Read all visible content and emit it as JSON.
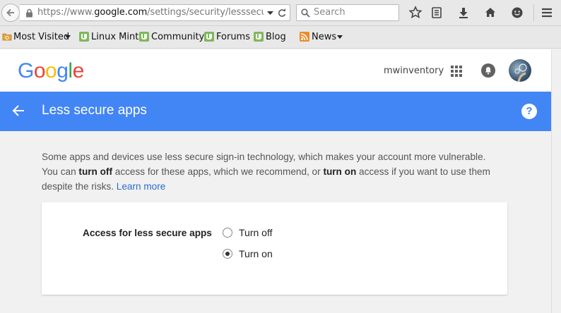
{
  "browser": {
    "url_prefix": "https://www.",
    "url_domain": "google.com",
    "url_path": "/settings/security/lesssecureapps",
    "search_placeholder": "Search"
  },
  "bookmarks": [
    {
      "label": "Most Visited",
      "icon": "folder-icon"
    },
    {
      "label": "Linux Mint",
      "icon": "mint-icon"
    },
    {
      "label": "Community",
      "icon": "mint-icon"
    },
    {
      "label": "Forums",
      "icon": "mint-icon"
    },
    {
      "label": "Blog",
      "icon": "mint-icon"
    },
    {
      "label": "News",
      "icon": "rss-icon"
    }
  ],
  "header": {
    "logo": "Google",
    "username": "mwinventory"
  },
  "bar": {
    "title": "Less secure apps",
    "help": "?"
  },
  "description": {
    "line1": "Some apps and devices use less secure sign-in technology, which makes your account more vulnerable.",
    "part1": "You can ",
    "bold1": "turn off",
    "part2": " access for these apps, which we recommend, or ",
    "bold2": "turn on",
    "part3": " access if you want to use them",
    "line3": "despite the risks. ",
    "link": "Learn more"
  },
  "card": {
    "label": "Access for less secure apps",
    "options": [
      {
        "label": "Turn off",
        "checked": false
      },
      {
        "label": "Turn on",
        "checked": true
      }
    ]
  },
  "colors": {
    "accent": "#4285f4",
    "link": "#2a6ccc"
  }
}
